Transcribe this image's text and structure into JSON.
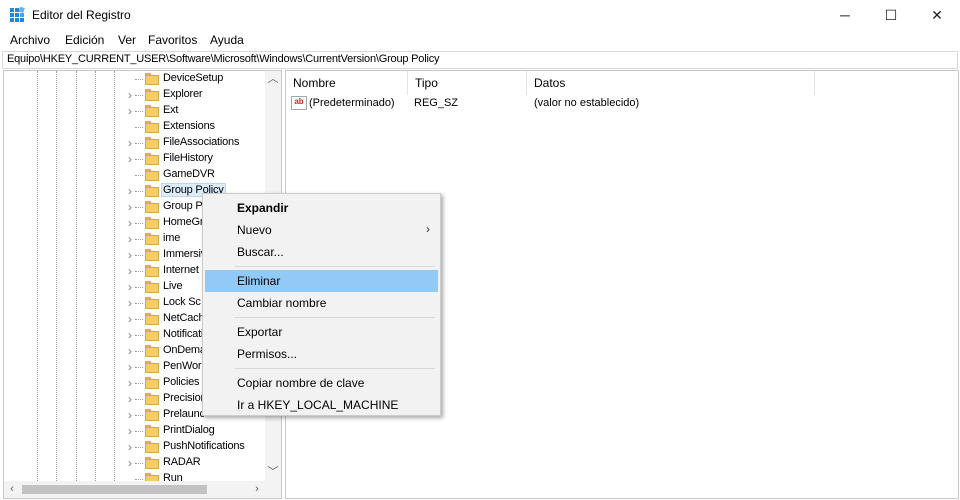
{
  "window": {
    "title": "Editor del Registro",
    "icon": "registry-editor-icon",
    "controls": {
      "minimize": "─",
      "maximize": "☐",
      "close": "✕"
    }
  },
  "menubar": {
    "items": [
      "Archivo",
      "Edición",
      "Ver",
      "Favoritos",
      "Ayuda"
    ]
  },
  "address": {
    "path": "Equipo\\HKEY_CURRENT_USER\\Software\\Microsoft\\Windows\\CurrentVersion\\Group Policy"
  },
  "tree": {
    "items": [
      {
        "label": "DeviceSetup",
        "expandable": false
      },
      {
        "label": "Explorer",
        "expandable": true
      },
      {
        "label": "Ext",
        "expandable": true
      },
      {
        "label": "Extensions",
        "expandable": false
      },
      {
        "label": "FileAssociations",
        "expandable": true
      },
      {
        "label": "FileHistory",
        "expandable": true
      },
      {
        "label": "GameDVR",
        "expandable": false
      },
      {
        "label": "Group Policy",
        "expandable": true,
        "selected": true
      },
      {
        "label": "Group Po",
        "expandable": true
      },
      {
        "label": "HomeGr",
        "expandable": true
      },
      {
        "label": "ime",
        "expandable": true
      },
      {
        "label": "Immersiv",
        "expandable": true
      },
      {
        "label": "Internet",
        "expandable": true
      },
      {
        "label": "Live",
        "expandable": true
      },
      {
        "label": "Lock Sc",
        "expandable": true
      },
      {
        "label": "NetCach",
        "expandable": true
      },
      {
        "label": "Notificati",
        "expandable": true
      },
      {
        "label": "OnDema",
        "expandable": true
      },
      {
        "label": "PenWork",
        "expandable": true
      },
      {
        "label": "Policies",
        "expandable": true
      },
      {
        "label": "Precision",
        "expandable": true
      },
      {
        "label": "Prelaunc",
        "expandable": true
      },
      {
        "label": "PrintDialog",
        "expandable": true
      },
      {
        "label": "PushNotifications",
        "expandable": true
      },
      {
        "label": "RADAR",
        "expandable": true
      },
      {
        "label": "Run",
        "expandable": false
      }
    ],
    "scroll": {
      "up": "︿",
      "down": "﹀",
      "left": "‹",
      "right": "›"
    }
  },
  "values": {
    "columns": [
      "Nombre",
      "Tipo",
      "Datos"
    ],
    "rows": [
      {
        "icon": "ab",
        "name": "(Predeterminado)",
        "type": "REG_SZ",
        "data": "(valor no establecido)"
      }
    ]
  },
  "context_menu": {
    "items": [
      {
        "label": "Expandir",
        "bold": true
      },
      {
        "label": "Nuevo",
        "submenu": true,
        "arrow": "›"
      },
      {
        "label": "Buscar..."
      },
      {
        "separator": true
      },
      {
        "label": "Eliminar",
        "highlighted": true
      },
      {
        "label": "Cambiar nombre"
      },
      {
        "separator": true
      },
      {
        "label": "Exportar"
      },
      {
        "label": "Permisos..."
      },
      {
        "separator": true
      },
      {
        "label": "Copiar nombre de clave"
      },
      {
        "label": "Ir a HKEY_LOCAL_MACHINE"
      }
    ]
  },
  "colors": {
    "highlight": "#91c9f7",
    "selection": "#dcecfb",
    "folder": "#f3cd67"
  }
}
